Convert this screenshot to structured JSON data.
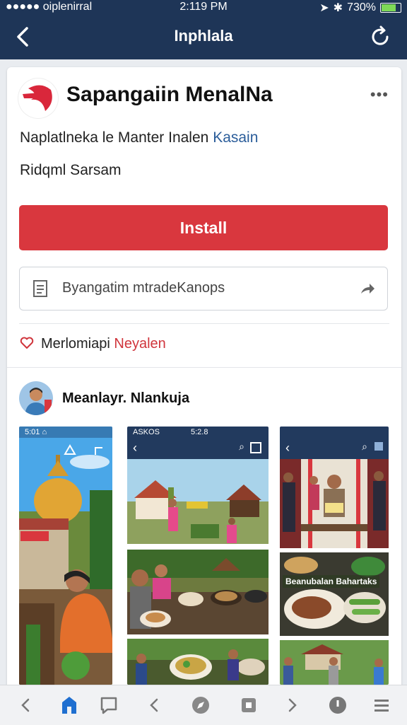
{
  "status_bar": {
    "carrier": "●●●●● oiplenirral",
    "time": "2:119 PM",
    "battery": "730%"
  },
  "nav": {
    "title": "Inphlala",
    "back_icon": "chevron-left-icon",
    "refresh_icon": "refresh-icon"
  },
  "app": {
    "name": "Sapangaiin MenalNa",
    "desc_line1_prefix": "Naplatlneka le Manter Inalen",
    "desc_line1_link": "Kasain",
    "desc_line2": "Ridqml Sarsam",
    "install_label": "Install",
    "share_label": "Byangatim mtradeKanops",
    "favorite_prefix": "Merlomiapi",
    "favorite_highlight": "Neyalen",
    "author_name": "Meanlayr. Nlankuja"
  },
  "screenshots": {
    "first_status": "5:01 ⌂",
    "second_status": "ASKOS",
    "second_time": "5:2.8",
    "banner": "Beanubalan Bahartaks"
  },
  "colors": {
    "nav_bg": "#1e3557",
    "install_bg": "#d9373e",
    "link": "#2b5d9a"
  },
  "bottom_tabs": [
    "back-icon",
    "home-icon",
    "chat-icon",
    "prev-icon",
    "compass-icon",
    "square-icon",
    "next-icon",
    "info-icon",
    "menu-icon"
  ]
}
